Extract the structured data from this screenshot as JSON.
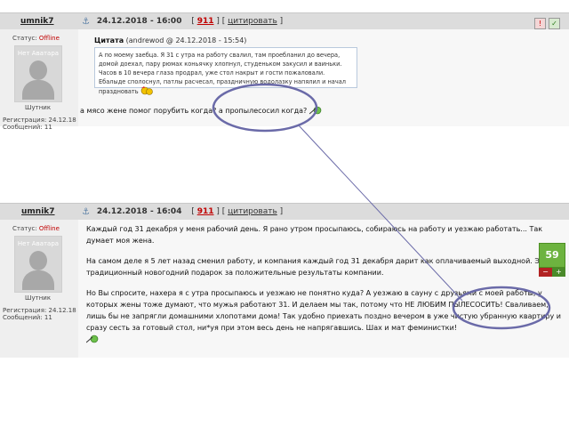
{
  "post1": {
    "username": "umnik7",
    "date": "24.12.2018 - 16:00",
    "post_number": "911",
    "quote_action": "цитировать",
    "status_label": "Статус:",
    "status_value": "Offline",
    "no_avatar": "Нет Аватара",
    "rank": "Шутник",
    "reg": "Регистрация: 24.12.18",
    "msgs": "Сообщений: 11",
    "quote_title": "Цитата",
    "quote_meta": "(andrewod @ 24.12.2018 - 15:54)",
    "quote_text": "А по моему заебца. Я 31 с утра на работу свалил, там проебланил до вечера, домой доехал, пару рюмах коньячку хлопнул, студеньком закусил и ваиньки. Часов в 10 вечера глаза продрал, уже стол накрыт и гости пожаловали. Ебалыде сполоснул, патлы расчесал, праздничную водолазку напялил и начал праздновать",
    "text": "а мясо жене помог порубить когда? а пропылесосил когда?"
  },
  "post2": {
    "username": "umnik7",
    "date": "24.12.2018 - 16:04",
    "post_number": "911",
    "quote_action": "цитировать",
    "status_label": "Статус:",
    "status_value": "Offline",
    "no_avatar": "Нет Аватара",
    "rank": "Шутник",
    "reg": "Регистрация: 24.12.18",
    "msgs": "Сообщений: 11",
    "paragraphs": [
      "Каждый год 31 декабря у меня рабочий день. Я рано утром просыпаюсь, собираюсь на работу и уезжаю работать... Так думает моя жена.",
      "На самом деле я 5 лет назад сменил работу, и компания каждый год 31 декабря дарит как оплачиваемый выходной. Это традиционный новогодний подарок за положительные результаты компании.",
      "Но Вы спросите, нахера я с утра просыпаюсь и уезжаю не понятно куда? А уезжаю в сауну с друзьями с моей работы, у которых жены тоже думают, что мужья работают 31. И делаем мы так, потому что НЕ ЛЮБИМ ПЫЛЕСОСИТЬ! Сваливаем, лишь бы не запрягли домашними хлопотами дома! Так удобно приехать поздно вечером в уже чистую убранную квартиру и сразу сесть за готовый стол, ни*уя при этом весь день не напрягавшись. Шах и мат феминистки!"
    ],
    "rating": "59",
    "minus": "−",
    "plus": "+"
  },
  "colors": {
    "header_bg": "#dcdcdc",
    "offline": "#c00000",
    "rating_bg": "#6db33f",
    "annotation": "#6a6aa8"
  }
}
